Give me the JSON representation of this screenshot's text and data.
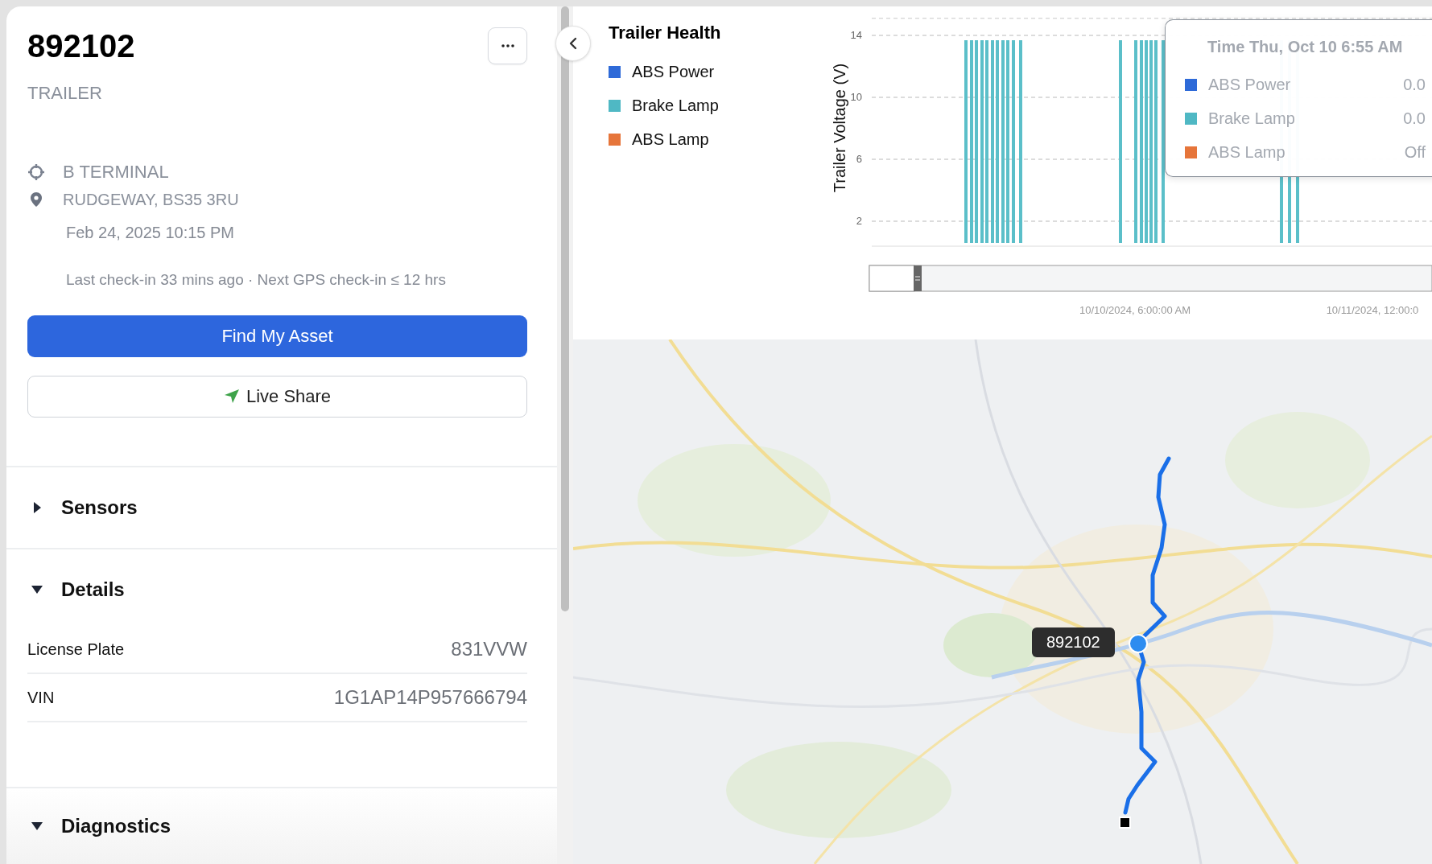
{
  "asset": {
    "title": "892102",
    "type": "TRAILER"
  },
  "location": {
    "terminal": "B TERMINAL",
    "address": "RUDGEWAY, BS35 3RU",
    "timestamp": "Feb 24, 2025 10:15 PM",
    "checkin": "Last check-in 33 mins ago · Next GPS check-in ≤ 12 hrs"
  },
  "buttons": [
    {
      "label": "Find My Asset",
      "kind": "primary"
    },
    {
      "label": "Live Share",
      "kind": "share"
    }
  ],
  "sections": [
    {
      "title": "Sensors",
      "expanded": false
    },
    {
      "title": "Details",
      "expanded": true,
      "fields": [
        {
          "label": "License Plate",
          "value": "831VVW"
        },
        {
          "label": "VIN",
          "value": "1G1AP14P957666794"
        }
      ]
    },
    {
      "title": "Diagnostics",
      "expanded": true
    }
  ],
  "chart_panel": {
    "title": "Trailer Health",
    "legend": [
      {
        "name": "ABS Power",
        "color": "#2e6ad8"
      },
      {
        "name": "Brake Lamp",
        "color": "#4fb8c4"
      },
      {
        "name": "ABS Lamp",
        "color": "#e6753a"
      }
    ],
    "y_axis": {
      "title": "Trailer Voltage (V)",
      "ticks": [
        "14",
        "10",
        "6",
        "2"
      ]
    },
    "x_axis": {
      "labels": [
        "10/10/2024, 6:00:00 AM",
        "10/11/2024, 12:00:0"
      ]
    },
    "tooltip": {
      "title": "Time Thu, Oct 10 6:55 AM",
      "rows": [
        {
          "name": "ABS Power",
          "color": "#2e6ad8",
          "value": "0.0"
        },
        {
          "name": "Brake Lamp",
          "color": "#4fb8c4",
          "value": "0.0"
        },
        {
          "name": "ABS Lamp",
          "color": "#e6753a",
          "value": "Off"
        }
      ]
    }
  },
  "map": {
    "kind": "picture",
    "marker": {
      "label": "892102"
    }
  }
}
